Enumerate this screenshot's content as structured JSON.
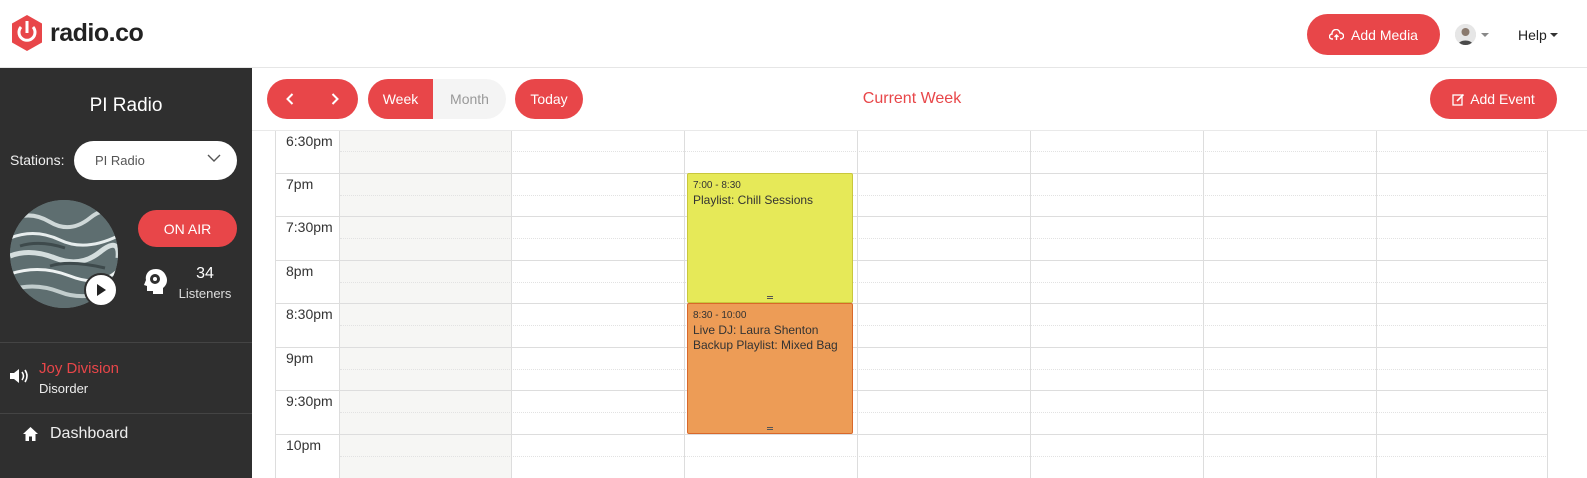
{
  "header": {
    "logo_text": "radio.co",
    "add_media_label": "Add Media",
    "help_label": "Help"
  },
  "sidebar": {
    "station_name": "PI Radio",
    "stations_label": "Stations:",
    "station_selected": "PI Radio",
    "on_air_label": "ON AIR",
    "listeners_count": "34",
    "listeners_label": "Listeners",
    "now_playing": {
      "artist": "Joy Division",
      "title": "Disorder"
    },
    "nav": [
      {
        "label": "Dashboard",
        "icon": "home-icon"
      }
    ]
  },
  "toolbar": {
    "week_label": "Week",
    "month_label": "Month",
    "today_label": "Today",
    "current_label": "Current Week",
    "add_event_label": "Add Event"
  },
  "calendar": {
    "times": [
      "6:30pm",
      "7pm",
      "7:30pm",
      "8pm",
      "8:30pm",
      "9pm",
      "9:30pm",
      "10pm"
    ],
    "events": [
      {
        "time": "7:00 - 8:30",
        "lines": [
          "Playlist: Chill Sessions"
        ],
        "color": "#e6e958",
        "border": "#c9c73c"
      },
      {
        "time": "8:30 - 10:00",
        "lines": [
          "Live DJ: Laura Shenton",
          "Backup Playlist: Mixed Bag"
        ],
        "color": "#ed9c56",
        "border": "#d9682a"
      }
    ]
  },
  "colors": {
    "accent": "#e84649",
    "sidebar_bg": "#2f2f2f"
  }
}
